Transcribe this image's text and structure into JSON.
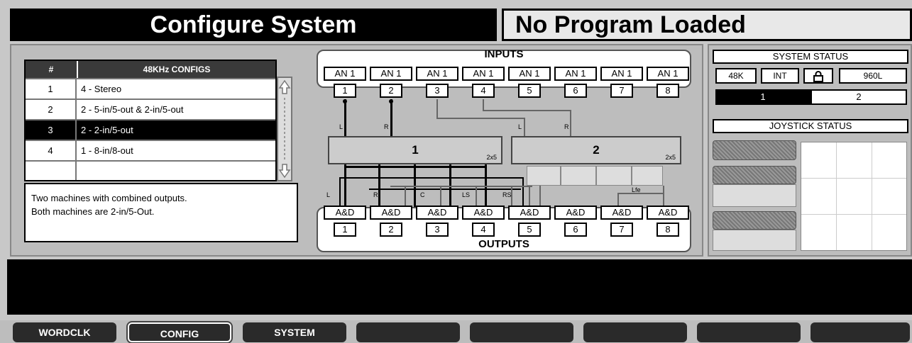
{
  "header": {
    "title": "Configure System",
    "program": "No Program Loaded"
  },
  "config_table": {
    "col_num": "#",
    "col_name": "48KHz CONFIGS",
    "rows": [
      {
        "num": "1",
        "name": "4 - Stereo"
      },
      {
        "num": "2",
        "name": "2 - 5-in/5-out & 2-in/5-out"
      },
      {
        "num": "3",
        "name": "2 - 2-in/5-out"
      },
      {
        "num": "4",
        "name": "1 - 8-in/8-out"
      }
    ],
    "selected_index": 2
  },
  "description": {
    "line1": "Two machines with combined outputs.",
    "line2": "Both machines are 2-in/5-Out."
  },
  "diagram": {
    "inputs_label": "INPUTS",
    "outputs_label": "OUTPUTS",
    "inputs": [
      {
        "type": "AN 1",
        "num": "1"
      },
      {
        "type": "AN 1",
        "num": "2"
      },
      {
        "type": "AN 1",
        "num": "3"
      },
      {
        "type": "AN 1",
        "num": "4"
      },
      {
        "type": "AN 1",
        "num": "5"
      },
      {
        "type": "AN 1",
        "num": "6"
      },
      {
        "type": "AN 1",
        "num": "7"
      },
      {
        "type": "AN 1",
        "num": "8"
      }
    ],
    "outputs": [
      {
        "type": "A&D",
        "num": "1"
      },
      {
        "type": "A&D",
        "num": "2"
      },
      {
        "type": "A&D",
        "num": "3"
      },
      {
        "type": "A&D",
        "num": "4"
      },
      {
        "type": "A&D",
        "num": "5"
      },
      {
        "type": "A&D",
        "num": "6"
      },
      {
        "type": "A&D",
        "num": "7"
      },
      {
        "type": "A&D",
        "num": "8"
      }
    ],
    "machine1": {
      "label": "1",
      "io": "2x5"
    },
    "machine2": {
      "label": "2",
      "io": "2x5"
    },
    "wire_labels": {
      "l1": "L",
      "r1": "R",
      "l2": "L",
      "r2": "R",
      "out_l": "L",
      "out_r": "R",
      "out_c": "C",
      "out_ls": "LS",
      "out_rs": "RS",
      "lfe": "Lfe"
    }
  },
  "system_status": {
    "title": "SYSTEM STATUS",
    "rate": "48K",
    "clock": "INT",
    "model": "960L",
    "machine1": "1",
    "machine2": "2"
  },
  "joystick": {
    "title": "JOYSTICK STATUS"
  },
  "soft_buttons": [
    "WORDCLK",
    "CONFIG",
    "SYSTEM",
    "",
    "",
    "",
    "",
    ""
  ]
}
